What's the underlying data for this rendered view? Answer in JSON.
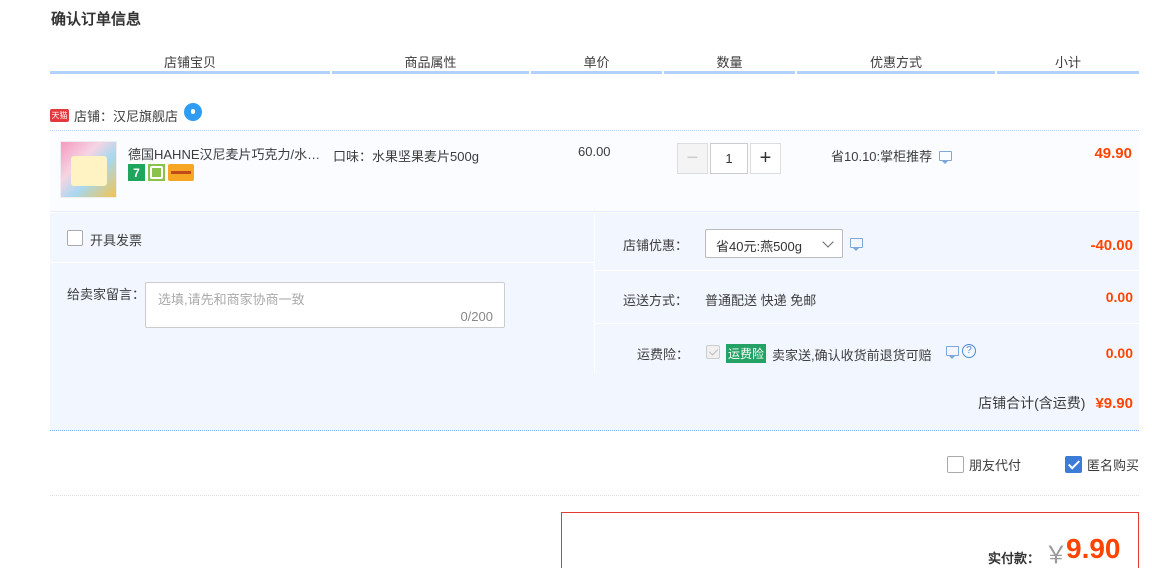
{
  "page_title": "确认订单信息",
  "columns": [
    "店铺宝贝",
    "商品属性",
    "单价",
    "数量",
    "优惠方式",
    "小计"
  ],
  "shop": {
    "badge": "天猫",
    "label": "店铺：汉尼旗舰店"
  },
  "item": {
    "title": "德国HAHNE汉尼麦片巧克力/水…",
    "service_icons": [
      "seven-day-return-icon",
      "green-service-icon",
      "card-icon"
    ],
    "seven_label": "7",
    "attribute": "口味：水果坚果麦片500g",
    "unit_price": "60.00",
    "quantity": "1",
    "minus": "−",
    "plus": "+",
    "promo": "省10.10:掌柜推荐",
    "subtotal": "49.90"
  },
  "invoice": {
    "label": "开具发票"
  },
  "message": {
    "label": "给卖家留言：",
    "placeholder": "选填,请先和商家协商一致",
    "count": "0/200"
  },
  "shop_discount": {
    "label": "店铺优惠：",
    "selected": "省40元:燕500g",
    "amount": "-40.00"
  },
  "shipping": {
    "label": "运送方式：",
    "value": "普通配送 快递 免邮",
    "amount": "0.00"
  },
  "insurance": {
    "label": "运费险：",
    "tag": "运费险",
    "text": "卖家送,确认收货前退货可赔",
    "help": "?",
    "amount": "0.00"
  },
  "shop_total": {
    "label": "店铺合计(含运费)",
    "value": "¥9.90"
  },
  "friend_pay": {
    "label": "朋友代付"
  },
  "anonymous": {
    "label": "匿名购买",
    "checked": true
  },
  "payment": {
    "label": "实付款：",
    "currency": "￥",
    "amount": "9.90"
  }
}
